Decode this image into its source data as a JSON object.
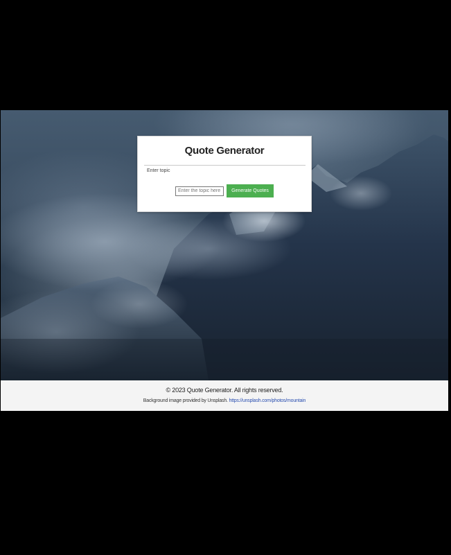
{
  "card": {
    "title": "Quote Generator",
    "hint": "Enter topic",
    "topic_input": {
      "value": "",
      "placeholder": "Enter the topic here"
    },
    "generate_button_label": "Generate Quotes"
  },
  "footer": {
    "copyright": "© 2023 Quote Generator. All rights reserved.",
    "credit_text": "Background image provided by Unsplash.",
    "credit_link": "https://unsplash.com/photos/mountain"
  },
  "colors": {
    "button": "#4caf50",
    "footer_bg": "#f4f4f4",
    "page_bg": "#000000"
  }
}
